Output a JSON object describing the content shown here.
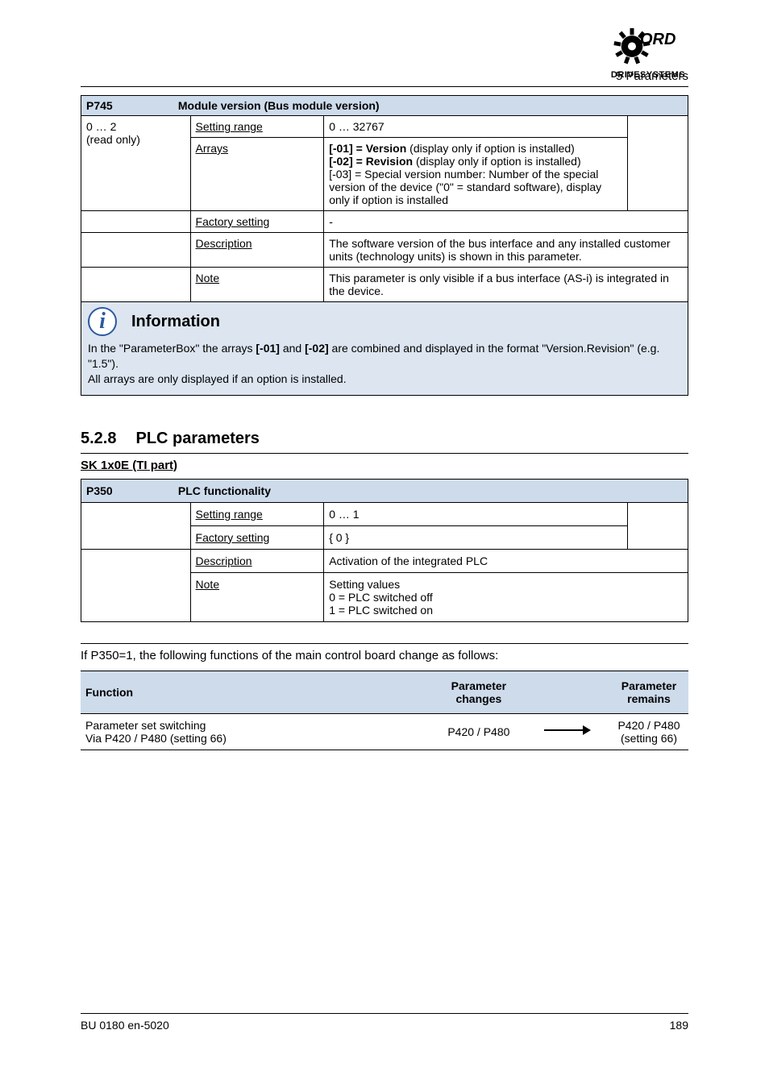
{
  "header": {
    "title": "5 Parameters"
  },
  "logo": {
    "top": "NORD",
    "bottom": "DRIVESYSTEMS"
  },
  "table1": {
    "head_code": "P745",
    "head_rest": "Module version (Bus module version)",
    "row1_left_line1": "0 … 2",
    "row1_left_line2": "(read only)",
    "row1_setrange": "Setting range",
    "row1_right": "0 … 32767",
    "row1_arrays_label": "Arrays",
    "row1_arrays_text_bold": "[-01] = Version",
    "row1_arrays_text_a": " (display only if option is installed)",
    "row1_arrays_text2_bold": "[-02] = Revision",
    "row1_arrays_text2_a": " (display only if option is installed)",
    "row1_arrays_text3": "[-03] = Special version number: Number of the special version of the device (\"0\" = standard software), display only if option is installed",
    "row2_factory": "Factory setting",
    "row2_dash": "-",
    "row3_desc_label": "Description",
    "row3_desc_text": "The software version of the bus interface and any installed customer units (technology units) is shown in this parameter.",
    "row4_note_label": "Note",
    "row4_note_text": "This parameter is only visible if a bus interface (AS-i) is integrated in the device.",
    "info_label": "Information",
    "info_text1": "In the \"ParameterBox\" the arrays ",
    "info_text1b": "[-01]",
    "info_text1c": " and ",
    "info_text1d": "[-02]",
    "info_text1e": " are combined and displayed in the format \"Version.Revision\" (e.g. \"1.5\").",
    "info_text2": "All arrays are only displayed if an option is installed."
  },
  "section": {
    "num": "5.2.8",
    "title": "PLC parameters",
    "sub": "SK 1x0E (TI part)"
  },
  "table2": {
    "head_code": "P350",
    "head_rest": "PLC functionality",
    "row_setrange": "Setting range",
    "row_setrange_val": "0 … 1",
    "row_factory": "Factory setting",
    "row_factory_val": "{ 0 }",
    "row_desc_label": "Description",
    "row_desc_text": "Activation of the integrated PLC",
    "row_note_label": "Note",
    "row_note_text": "Setting values",
    "row_note0": "0 = PLC switched off",
    "row_note1": "1 = PLC switched on"
  },
  "func": {
    "caption": "If P350=1, the following functions of the main control board change as follows:",
    "col1": "Function",
    "col2": "Parameter changes",
    "col3": "Parameter remains",
    "c1a": "Parameter set switching",
    "c1b": "Via P420 / P480 (setting 66)",
    "c2": "P420 / P480",
    "c3a": "P420 / P480",
    "c3b": "(setting 66)"
  },
  "footer": {
    "left": "BU 0180 en-5020",
    "right": "189"
  }
}
